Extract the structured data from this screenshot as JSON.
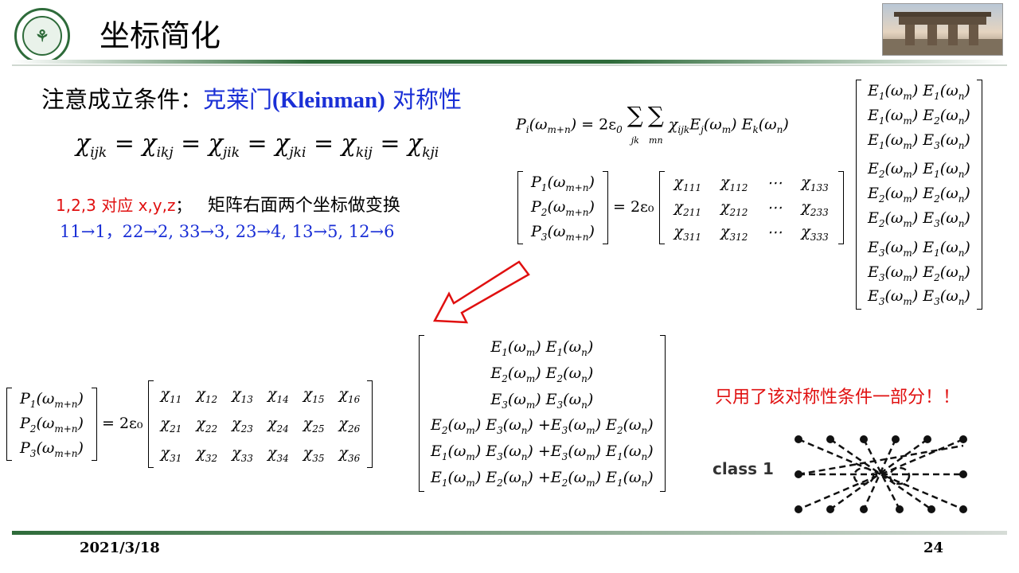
{
  "header": {
    "title": "坐标简化",
    "logo_icon": "university-seal-icon",
    "banner_icon": "campus-gate-photo"
  },
  "note": {
    "prefix": "注意成立条件：",
    "highlight": "克莱门",
    "name": "(Kleinman)",
    "suffix": "对称性"
  },
  "symmetry": {
    "subs": [
      "ijk",
      "ikj",
      "jik",
      "jki",
      "kij",
      "kji"
    ]
  },
  "mapping": {
    "line1_red": "1,2,3 对应 x,y,z",
    "line1_sep": "；",
    "line1_black": "矩阵右面两个坐标做变换",
    "line2": "11→1，22→2, 33→3, 23→4, 13→5, 12→6"
  },
  "top_equation": {
    "lhs": "P",
    "lhs_sub": "i",
    "coef": "= 2ε",
    "sum1": "jk",
    "sum2": "mn"
  },
  "matrix_top": {
    "lhs": [
      "P₁(ω_m+n)",
      "P₂(ω_m+n)",
      "P₃(ω_m+n)"
    ],
    "coef": "= 2ε₀",
    "chi": [
      [
        "χ111",
        "χ112",
        "⋯",
        "χ133"
      ],
      [
        "χ211",
        "χ212",
        "⋯",
        "χ233"
      ],
      [
        "χ311",
        "χ312",
        "⋯",
        "χ333"
      ]
    ],
    "fields": [
      [
        "1",
        "1"
      ],
      [
        "1",
        "2"
      ],
      [
        "1",
        "3"
      ],
      [
        "2",
        "1"
      ],
      [
        "2",
        "2"
      ],
      [
        "2",
        "3"
      ],
      [
        "3",
        "1"
      ],
      [
        "3",
        "2"
      ],
      [
        "3",
        "3"
      ]
    ]
  },
  "matrix_bottom": {
    "coef": "= 2ε₀",
    "chi_rows": [
      "1",
      "2",
      "3"
    ],
    "chi_cols": [
      "1",
      "2",
      "3",
      "4",
      "5",
      "6"
    ],
    "fields": [
      {
        "a": "1",
        "b": "1"
      },
      {
        "a": "2",
        "b": "2"
      },
      {
        "a": "3",
        "b": "3"
      },
      {
        "a": "2",
        "b": "3",
        "c": "3",
        "d": "2"
      },
      {
        "a": "1",
        "b": "3",
        "c": "3",
        "d": "1"
      },
      {
        "a": "1",
        "b": "2",
        "c": "2",
        "d": "1"
      }
    ]
  },
  "warning": "只用了该对称性条件一部分！！",
  "figure_label": "class 1",
  "footer": {
    "date": "2021/3/18",
    "page": "24"
  },
  "colors": {
    "green": "#2e6b3a",
    "blue": "#1a2fd6",
    "red": "#e01010"
  }
}
